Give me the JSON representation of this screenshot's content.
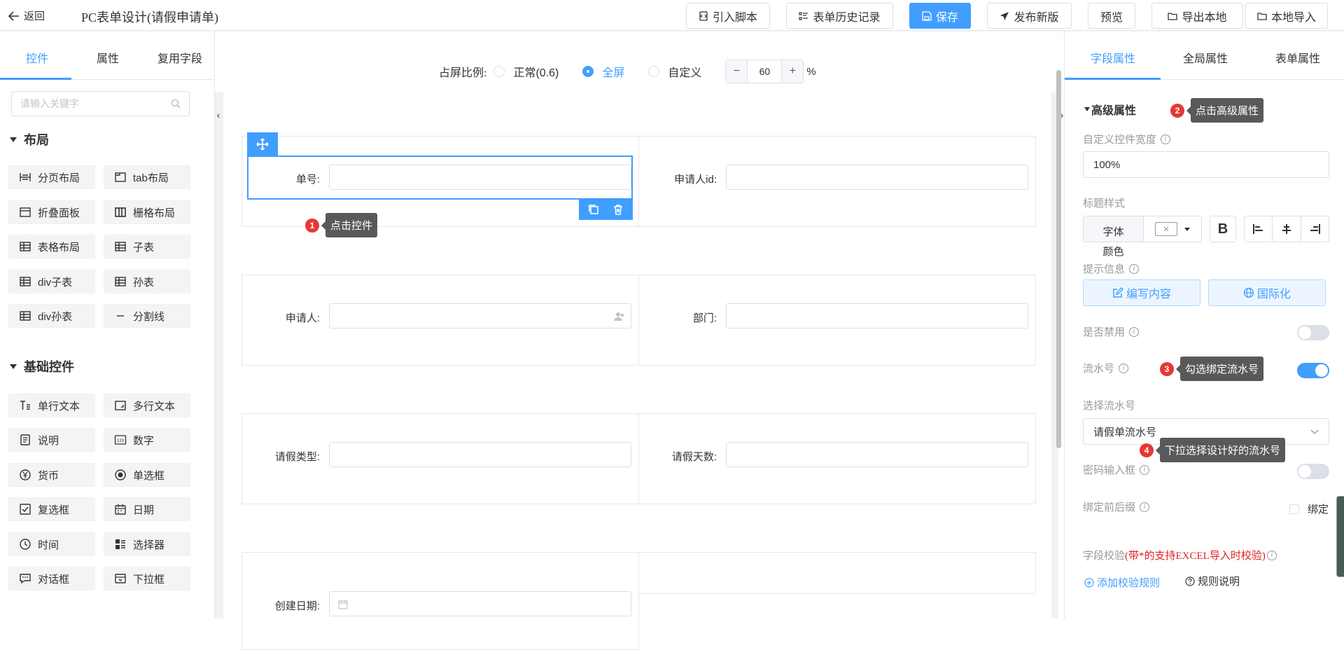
{
  "topbar": {
    "back_label": "返回",
    "page_title": "PC表单设计(请假申请单)",
    "buttons": {
      "import_script": "引入脚本",
      "history": "表单历史记录",
      "save": "保存",
      "publish": "发布新版",
      "preview": "预览",
      "export": "导出本地",
      "import_local": "本地导入"
    }
  },
  "left_panel": {
    "tabs": [
      "控件",
      "属性",
      "复用字段"
    ],
    "active_tab": 0,
    "search": {
      "placeholder": "请输入关键字",
      "value": ""
    },
    "sections": [
      {
        "title": "布局",
        "items": [
          "分页布局",
          "tab布局",
          "折叠面板",
          "栅格布局",
          "表格布局",
          "子表",
          "div子表",
          "孙表",
          "div孙表",
          "分割线"
        ]
      },
      {
        "title": "基础控件",
        "items": [
          "单行文本",
          "多行文本",
          "说明",
          "数字",
          "货币",
          "单选框",
          "复选框",
          "日期",
          "时间",
          "选择器",
          "对话框",
          "下拉框"
        ]
      }
    ]
  },
  "canvas": {
    "ratio": {
      "label": "占屏比例:",
      "options": [
        "正常(0.6)",
        "全屏",
        "自定义"
      ],
      "selected": "全屏",
      "value": "60",
      "unit": "%",
      "minus": "−",
      "plus": "+"
    },
    "fields": [
      {
        "label": "单号:",
        "selected": true
      },
      {
        "label": "申请人id:"
      },
      {
        "label": "申请人:",
        "icon": "user-select-icon"
      },
      {
        "label": "部门:"
      },
      {
        "label": "请假类型:"
      },
      {
        "label": "请假天数:"
      },
      {
        "label": "创建日期:",
        "icon": "calendar-icon"
      }
    ]
  },
  "tips": [
    {
      "num": "1",
      "text": "点击控件"
    },
    {
      "num": "2",
      "text": "点击高级属性"
    },
    {
      "num": "3",
      "text": "勾选绑定流水号"
    },
    {
      "num": "4",
      "text": "下拉选择设计好的流水号"
    }
  ],
  "right_panel": {
    "tabs": [
      "字段属性",
      "全局属性",
      "表单属性"
    ],
    "active_tab": 0,
    "section_title": "高级属性",
    "custom_width": {
      "label": "自定义控件宽度",
      "value": "100%"
    },
    "title_style": {
      "label": "标题样式",
      "font_color_label": "字体颜色",
      "bold": "B"
    },
    "hint": {
      "label": "提示信息",
      "edit_button": "编写内容",
      "i18n_button": "国际化"
    },
    "disabled": {
      "label": "是否禁用",
      "on": false
    },
    "serial": {
      "label": "流水号",
      "on": true
    },
    "serial_select": {
      "label": "选择流水号",
      "value": "请假单流水号"
    },
    "password": {
      "label": "密码输入框",
      "on": false
    },
    "bind_affix": {
      "label": "绑定前后缀",
      "checkbox_label": "绑定",
      "checked": false
    },
    "validation": {
      "label": "字段校验",
      "note": "(带*的支持EXCEL导入时校验)",
      "add_rule": "添加校验规则",
      "rule_help": "规则说明"
    }
  },
  "colors": {
    "accent": "#409eff",
    "tip_bg": "#595959",
    "badge": "#e53935",
    "note_red": "#e02020"
  }
}
